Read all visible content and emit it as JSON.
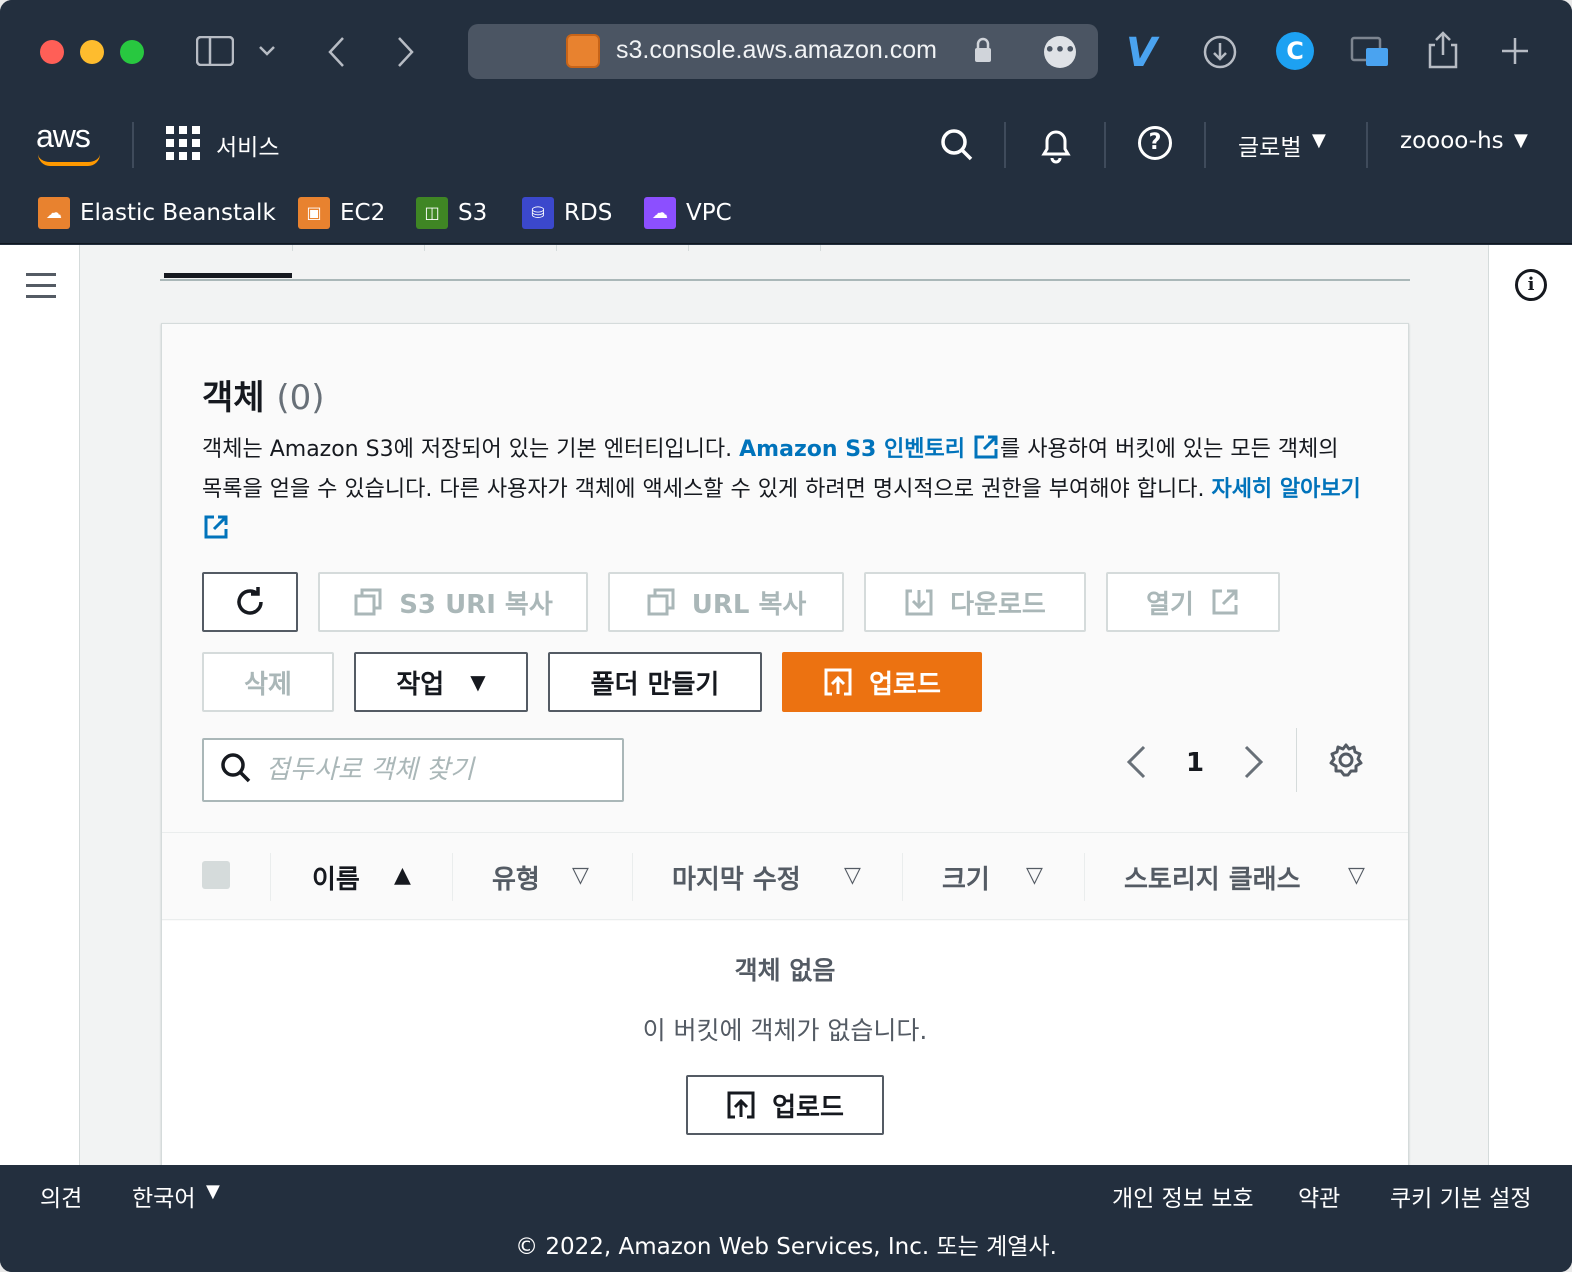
{
  "browser": {
    "url": "s3.console.aws.amazon.com"
  },
  "nav": {
    "logo": "aws",
    "services_label": "서비스",
    "region_label": "글로벌",
    "account_label": "zoooo-hs"
  },
  "favorites": [
    {
      "label": "Elastic Beanstalk",
      "color": "#e8822f"
    },
    {
      "label": "EC2",
      "color": "#e8822f"
    },
    {
      "label": "S3",
      "color": "#3f8624"
    },
    {
      "label": "RDS",
      "color": "#3b48cc"
    },
    {
      "label": "VPC",
      "color": "#8c4fff"
    }
  ],
  "objects_panel": {
    "title": "객체",
    "count": "(0)",
    "desc_part1": "객체는 Amazon S3에 저장되어 있는 기본 엔터티입니다. ",
    "inventory_link": "Amazon S3 인벤토리",
    "desc_part2": "를 사용하여 버킷에 있는 모든 객체의 목록을 얻을 수 있습니다. 다른 사용자가 객체에 액세스할 수 있게 하려면 명시적으로 권한을 부여해야 합니다. ",
    "learn_more_link": "자세히 알아보기"
  },
  "toolbar": {
    "copy_s3_uri": "S3 URI 복사",
    "copy_url": "URL 복사",
    "download": "다운로드",
    "open": "열기",
    "delete": "삭제",
    "actions": "작업",
    "create_folder": "폴더 만들기",
    "upload": "업로드"
  },
  "search": {
    "placeholder": "접두사로 객체 찾기"
  },
  "pagination": {
    "current_page": "1"
  },
  "table": {
    "columns": [
      "이름",
      "유형",
      "마지막 수정",
      "크기",
      "스토리지 클래스"
    ],
    "empty_title": "객체 없음",
    "empty_text": "이 버킷에 객체가 없습니다.",
    "empty_upload": "업로드"
  },
  "footer": {
    "feedback": "의견",
    "language": "한국어",
    "privacy": "개인 정보 보호",
    "terms": "약관",
    "cookies": "쿠키 기본 설정",
    "copyright": "© 2022, Amazon Web Services, Inc. 또는 계열사."
  }
}
